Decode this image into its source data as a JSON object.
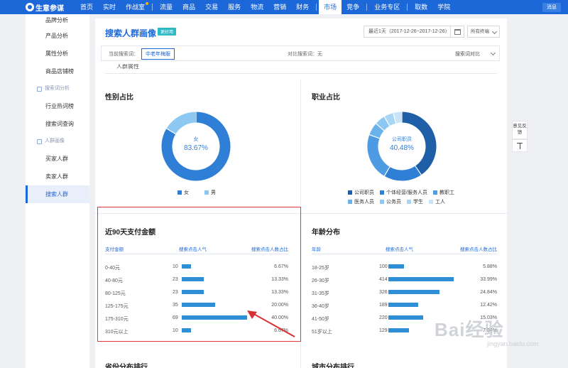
{
  "nav": {
    "brand": "生意参谋",
    "items": [
      "首页",
      "实时",
      "作战室",
      "流量",
      "商品",
      "交易",
      "服务",
      "物流",
      "营销",
      "财务",
      "市场",
      "竞争",
      "业务专区",
      "取数",
      "学院"
    ],
    "active": "市场",
    "message": "消息"
  },
  "sidebar": {
    "items": [
      {
        "label": "品牌分析",
        "type": "item"
      },
      {
        "label": "产品分析",
        "type": "item"
      },
      {
        "label": "属性分析",
        "type": "item"
      },
      {
        "label": "商品店铺榜",
        "type": "item"
      },
      {
        "label": "搜索词分析",
        "type": "group"
      },
      {
        "label": "行业热词榜",
        "type": "item"
      },
      {
        "label": "搜索词查询",
        "type": "item"
      },
      {
        "label": "人群画像",
        "type": "group"
      },
      {
        "label": "买家人群",
        "type": "item"
      },
      {
        "label": "卖家人群",
        "type": "item"
      },
      {
        "label": "搜索人群",
        "type": "item",
        "active": true
      }
    ]
  },
  "header": {
    "title": "搜索人群画像",
    "badge": "更好用",
    "date_range": "最近1天（2017-12-26~2017-12-26）",
    "terminal": "所有终端",
    "current_term_label": "当前搜索词：",
    "current_term": "中老年梅服",
    "compare_label": "对比搜索词：无",
    "compare_button": "搜索词对比"
  },
  "section_title": "人群属性",
  "gender": {
    "title": "性别占比",
    "center_label": "女",
    "center_value": "83.67%",
    "slices": [
      {
        "name": "女",
        "value": 83.67,
        "color": "#2f7fd6"
      },
      {
        "name": "男",
        "value": 16.33,
        "color": "#8cc8f2"
      }
    ]
  },
  "occupation": {
    "title": "职业占比",
    "center_label": "公司职员",
    "center_value": "40.48%",
    "slices": [
      {
        "name": "公司职员",
        "value": 40.48,
        "color": "#1e5fa8"
      },
      {
        "name": "个体经营/服务人员",
        "value": 18.0,
        "color": "#2f7fd6"
      },
      {
        "name": "教职工",
        "value": 22.0,
        "color": "#4e9be4"
      },
      {
        "name": "医务人员",
        "value": 6.0,
        "color": "#6ab2ec"
      },
      {
        "name": "公务员",
        "value": 5.0,
        "color": "#8cc8f2"
      },
      {
        "name": "学生",
        "value": 4.5,
        "color": "#aad6f5"
      },
      {
        "name": "工人",
        "value": 4.02,
        "color": "#c8e4f8"
      }
    ],
    "legend": [
      "公司职员",
      "个体经营/服务人员",
      "教职工",
      "医务人员",
      "公务员",
      "学生",
      "工人"
    ]
  },
  "payment": {
    "title": "近90天支付金额",
    "columns": [
      "支付金额",
      "搜索点击人气",
      "搜索点击人数占比"
    ],
    "rows": [
      {
        "label": "0-40元",
        "value": "10",
        "pct": "6.67%",
        "num": 10
      },
      {
        "label": "40-80元",
        "value": "23",
        "pct": "13.33%",
        "num": 23
      },
      {
        "label": "80-125元",
        "value": "23",
        "pct": "13.33%",
        "num": 23
      },
      {
        "label": "125-175元",
        "value": "35",
        "pct": "20.00%",
        "num": 35
      },
      {
        "label": "175-310元",
        "value": "69",
        "pct": "40.00%",
        "num": 69
      },
      {
        "label": "310元以上",
        "value": "10",
        "pct": "6.67%",
        "num": 10
      }
    ]
  },
  "age": {
    "title": "年龄分布",
    "columns": [
      "年龄",
      "搜索点击人气",
      "搜索点击人数占比"
    ],
    "rows": [
      {
        "label": "18-25岁",
        "value": "100",
        "pct": "5.88%",
        "num": 100
      },
      {
        "label": "26-30岁",
        "value": "414",
        "pct": "33.99%",
        "num": 414
      },
      {
        "label": "31-35岁",
        "value": "326",
        "pct": "24.84%",
        "num": 326
      },
      {
        "label": "36-40岁",
        "value": "189",
        "pct": "12.42%",
        "num": 189
      },
      {
        "label": "41-50岁",
        "value": "220",
        "pct": "15.03%",
        "num": 220
      },
      {
        "label": "51岁以上",
        "value": "129",
        "pct": "7.84%",
        "num": 129
      }
    ]
  },
  "province_title": "省份分布排行",
  "city_title": "城市分布排行",
  "feedback": "意见反馈",
  "watermark": {
    "logo": "Bai经验",
    "url": "jingyan.baidu.com"
  }
}
